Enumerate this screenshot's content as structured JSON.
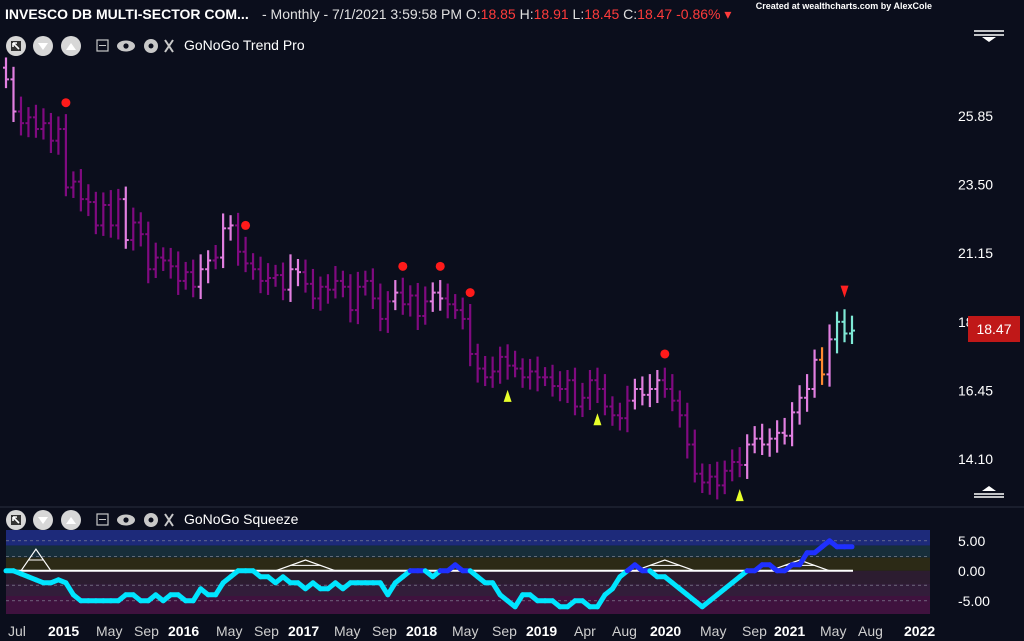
{
  "header": {
    "title": "INVESCO DB MULTI-SECTOR COM...",
    "interval": "- Monthly - 7/1/2021 3:59:58 PM",
    "open_label": "O:",
    "open_value": "18.85",
    "high_label": "H:",
    "high_value": "18.91",
    "low_label": "L:",
    "low_value": "18.45",
    "close_label": "C:",
    "close_value": "18.47",
    "change": "-0.86%",
    "credit": "Created at wealthcharts.com by AlexCole"
  },
  "price_panel": {
    "label": "GoNoGo Trend Pro",
    "last_price_tag": "18.47"
  },
  "squeeze_panel": {
    "label": "GoNoGo Squeeze"
  },
  "icons": {
    "tool_1": "cursor-icon",
    "tool_2": "chevron-down-icon",
    "tool_3": "chevron-up-icon",
    "collapse": "square-icon",
    "visibility": "eye-icon",
    "settings": "gear-icon",
    "close": "close-icon"
  },
  "colors": {
    "background": "#0b0e1c",
    "strong_nogo": "#800a80",
    "weak_nogo": "#e27fe0",
    "neutral": "#ff8a30",
    "weak_go": "#7fe9d6",
    "oscillator": "#00e5ff",
    "oscillator_bull": "#1f30ff",
    "price_tag": "#c01818"
  },
  "chart_data": [
    {
      "type": "line",
      "subtype": "ohlc-monthly",
      "title": "GoNoGo Trend Pro",
      "x_ticks": [
        "Jul",
        "2015",
        "May",
        "Sep",
        "2016",
        "May",
        "Sep",
        "2017",
        "May",
        "Sep",
        "2018",
        "May",
        "Sep",
        "2019",
        "Apr",
        "Aug",
        "2020",
        "May",
        "Sep",
        "2021",
        "May",
        "Aug",
        "2022"
      ],
      "y_ticks": [
        "25.85",
        "23.50",
        "21.15",
        "18.80",
        "16.45",
        "14.10"
      ],
      "ylim": [
        12.7,
        27.9
      ],
      "last_price": 18.47,
      "close": [
        27.1,
        26.0,
        25.6,
        25.8,
        25.4,
        25.6,
        25.0,
        25.4,
        23.4,
        23.6,
        23.0,
        22.9,
        22.1,
        22.8,
        22.1,
        23.0,
        21.6,
        22.2,
        21.8,
        20.6,
        21.0,
        20.9,
        20.7,
        20.2,
        20.5,
        20.0,
        20.6,
        20.9,
        21.0,
        22.0,
        22.1,
        21.2,
        20.8,
        20.6,
        20.2,
        20.3,
        20.4,
        19.9,
        20.6,
        20.5,
        20.1,
        19.6,
        20.0,
        19.9,
        20.2,
        20.0,
        19.2,
        20.0,
        20.2,
        19.6,
        18.9,
        19.5,
        19.8,
        19.4,
        19.7,
        19.0,
        19.5,
        19.8,
        19.6,
        19.4,
        19.2,
        18.9,
        17.7,
        17.2,
        16.9,
        17.1,
        17.6,
        17.3,
        17.2,
        16.9,
        17.1,
        16.9,
        16.9,
        16.6,
        16.5,
        16.8,
        15.9,
        16.2,
        16.8,
        16.5,
        15.9,
        15.6,
        15.5,
        16.1,
        16.5,
        16.3,
        16.5,
        16.8,
        16.5,
        16.1,
        15.6,
        14.6,
        13.6,
        13.3,
        13.5,
        13.2,
        13.7,
        14.0,
        13.9,
        14.6,
        14.8,
        14.6,
        14.8,
        15.0,
        14.9,
        15.7,
        16.2,
        16.5,
        17.5,
        17.0,
        18.2,
        18.8,
        18.4,
        18.5
      ],
      "trend_colors": [
        "weak_nogo",
        "weak_nogo",
        "strong_nogo",
        "strong_nogo",
        "strong_nogo",
        "strong_nogo",
        "strong_nogo",
        "strong_nogo",
        "strong_nogo",
        "strong_nogo",
        "strong_nogo",
        "strong_nogo",
        "strong_nogo",
        "strong_nogo",
        "strong_nogo",
        "strong_nogo",
        "weak_nogo",
        "strong_nogo",
        "strong_nogo",
        "strong_nogo",
        "strong_nogo",
        "strong_nogo",
        "strong_nogo",
        "strong_nogo",
        "strong_nogo",
        "strong_nogo",
        "weak_nogo",
        "weak_nogo",
        "strong_nogo",
        "weak_nogo",
        "weak_nogo",
        "strong_nogo",
        "strong_nogo",
        "strong_nogo",
        "strong_nogo",
        "strong_nogo",
        "strong_nogo",
        "strong_nogo",
        "weak_nogo",
        "weak_nogo",
        "strong_nogo",
        "strong_nogo",
        "strong_nogo",
        "strong_nogo",
        "strong_nogo",
        "strong_nogo",
        "strong_nogo",
        "strong_nogo",
        "strong_nogo",
        "strong_nogo",
        "strong_nogo",
        "strong_nogo",
        "weak_nogo",
        "strong_nogo",
        "strong_nogo",
        "strong_nogo",
        "strong_nogo",
        "weak_nogo",
        "weak_nogo",
        "strong_nogo",
        "strong_nogo",
        "strong_nogo",
        "strong_nogo",
        "strong_nogo",
        "strong_nogo",
        "strong_nogo",
        "strong_nogo",
        "strong_nogo",
        "strong_nogo",
        "strong_nogo",
        "strong_nogo",
        "strong_nogo",
        "strong_nogo",
        "strong_nogo",
        "strong_nogo",
        "strong_nogo",
        "strong_nogo",
        "strong_nogo",
        "strong_nogo",
        "strong_nogo",
        "strong_nogo",
        "strong_nogo",
        "strong_nogo",
        "strong_nogo",
        "weak_nogo",
        "weak_nogo",
        "weak_nogo",
        "weak_nogo",
        "strong_nogo",
        "strong_nogo",
        "strong_nogo",
        "strong_nogo",
        "strong_nogo",
        "strong_nogo",
        "strong_nogo",
        "strong_nogo",
        "strong_nogo",
        "strong_nogo",
        "strong_nogo",
        "weak_nogo",
        "weak_nogo",
        "weak_nogo",
        "weak_nogo",
        "weak_nogo",
        "weak_nogo",
        "weak_nogo",
        "weak_nogo",
        "weak_nogo",
        "weak_nogo",
        "neutral",
        "weak_nogo",
        "weak_go",
        "weak_go",
        "weak_go",
        "weak_go"
      ],
      "countertrend_dots_bar_index": [
        8,
        32,
        53,
        58,
        62,
        88
      ],
      "go_triangles_bar_index": [
        67,
        79,
        98
      ],
      "nogo_triangle_bar_index": [
        112
      ]
    },
    {
      "type": "line",
      "title": "GoNoGo Squeeze",
      "y_ticks": [
        "5.00",
        "0.00",
        "-5.00"
      ],
      "ylim": [
        -7.2,
        6.8
      ],
      "zero_line": 0,
      "oscillator": [
        0,
        0,
        -0.5,
        -1,
        -1.5,
        -2,
        -2,
        -1.5,
        -2,
        -4,
        -5,
        -5,
        -5,
        -5,
        -5,
        -5,
        -4,
        -4,
        -5,
        -5,
        -4,
        -5,
        -4,
        -4,
        -5,
        -5,
        -3,
        -4,
        -4,
        -2,
        -1,
        0,
        0,
        0,
        -1,
        -1,
        -2,
        -1,
        -2,
        -2,
        -3,
        -2,
        -3,
        -3,
        -2,
        -3,
        -2,
        -2,
        -2,
        -2,
        -2,
        -4,
        -2,
        -1,
        0,
        0,
        0,
        -1,
        0,
        0,
        1,
        0,
        0,
        -1,
        -2,
        -2,
        -4,
        -5,
        -6,
        -4,
        -4,
        -5,
        -5,
        -5,
        -6,
        -6,
        -5,
        -5,
        -6,
        -6,
        -4,
        -3,
        -1,
        0,
        1,
        0,
        0,
        -1,
        -1,
        -2,
        -3,
        -4,
        -5,
        -6,
        -5,
        -4,
        -3,
        -2,
        -1,
        0,
        0,
        1,
        1,
        0,
        0,
        1,
        1,
        3,
        3,
        4,
        5,
        4,
        4,
        4
      ]
    }
  ]
}
